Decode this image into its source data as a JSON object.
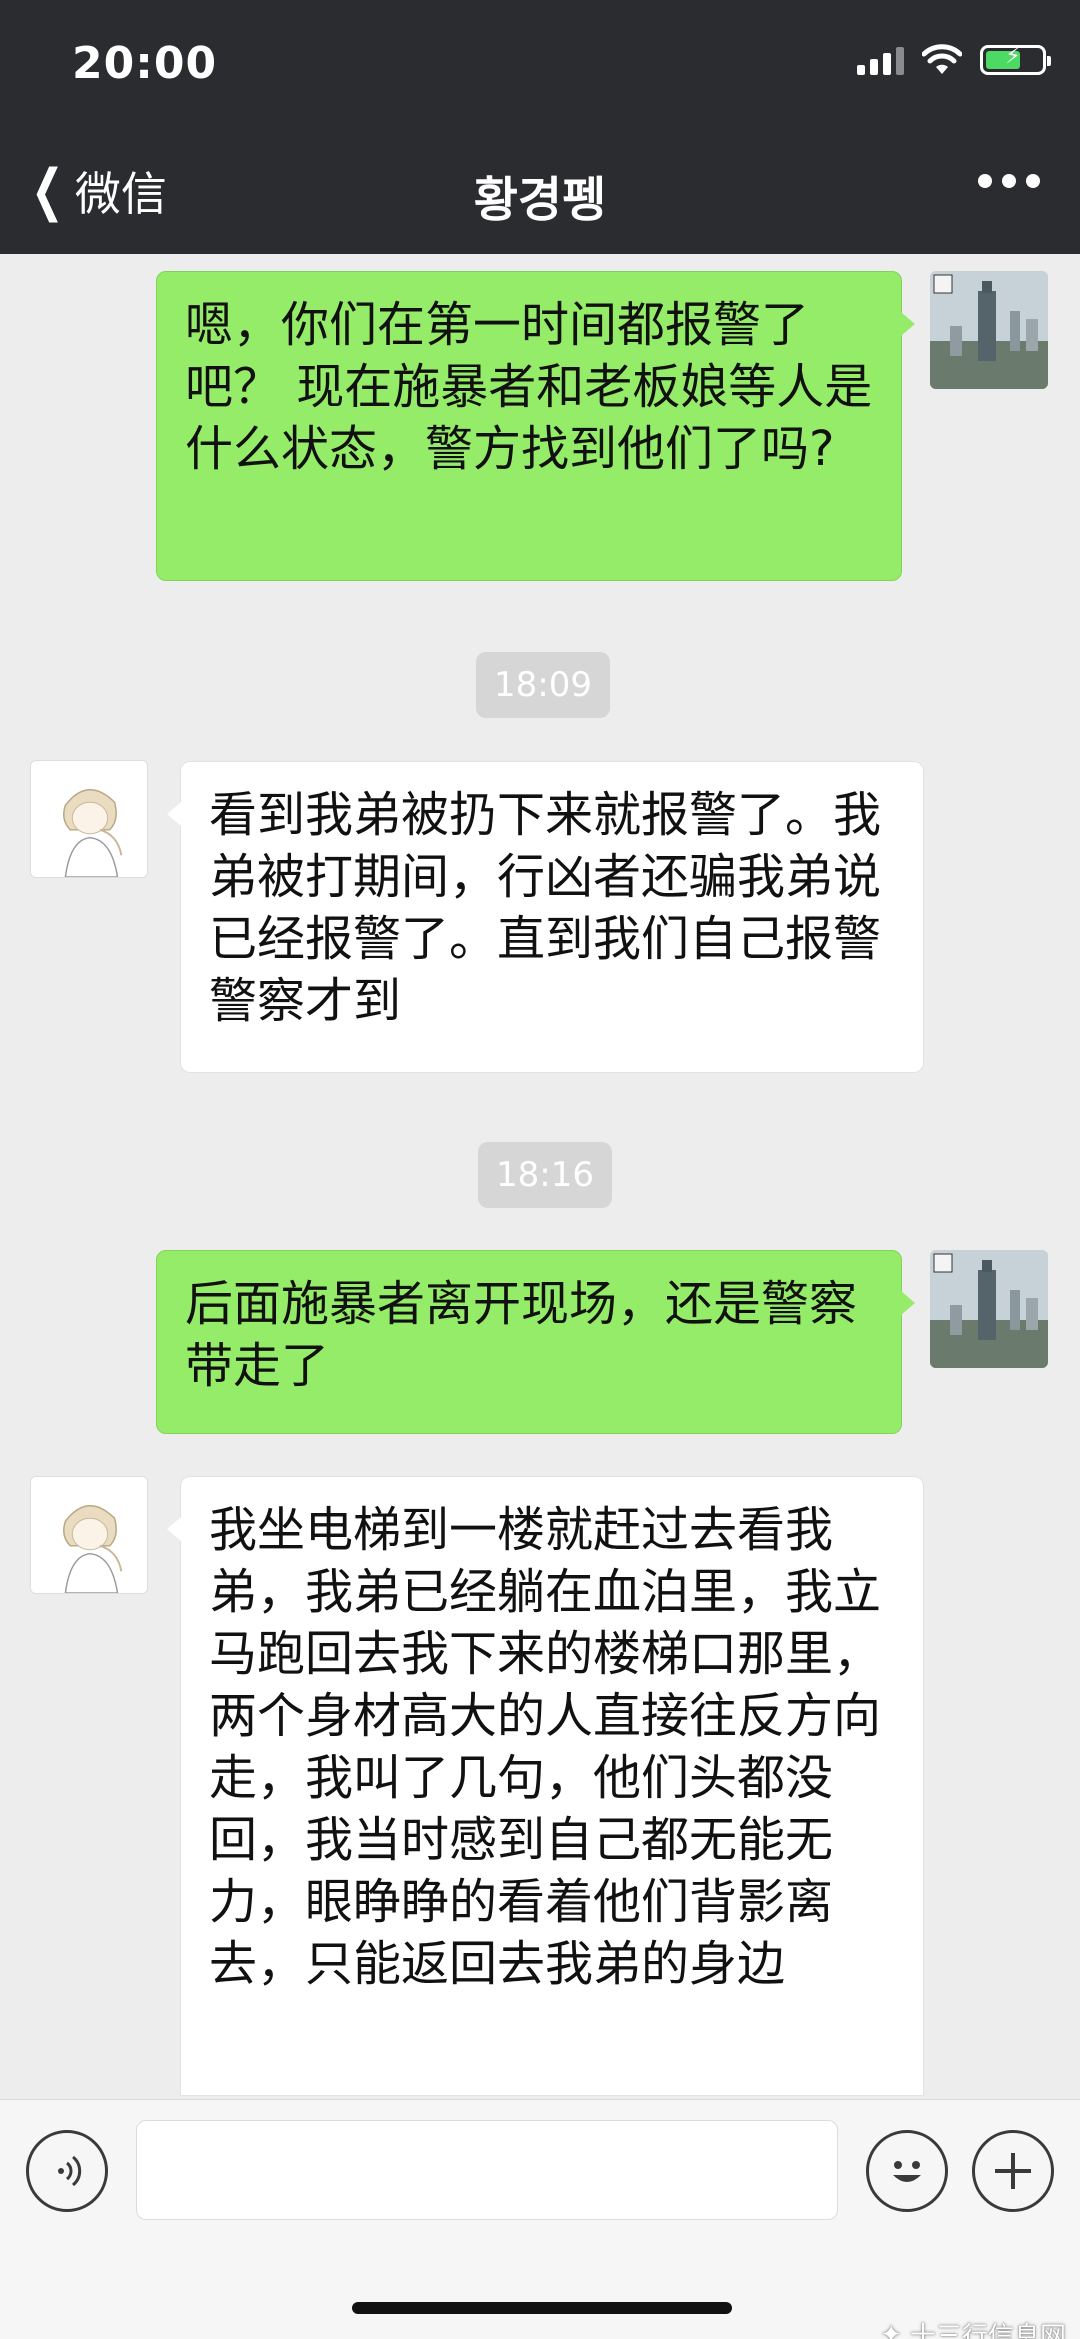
{
  "status_bar": {
    "time": "20:00"
  },
  "nav": {
    "back_label": "微信",
    "title": "황경펭"
  },
  "messages": [
    {
      "sender": "self",
      "text": "嗯，你们在第一时间都报警了吧？ 现在施暴者和老板娘等人是什么状态，警方找到他们了吗?"
    },
    {
      "type": "timestamp",
      "text": "18:09"
    },
    {
      "sender": "other",
      "text": "看到我弟被扔下来就报警了。我弟被打期间，行凶者还骗我弟说已经报警了。直到我们自己报警警察才到"
    },
    {
      "type": "timestamp",
      "text": "18:16"
    },
    {
      "sender": "self",
      "text": "后面施暴者离开现场，还是警察带走了"
    },
    {
      "sender": "other",
      "text": "我坐电梯到一楼就赶过去看我弟，我弟已经躺在血泊里，我立马跑回去我下来的楼梯口那里，两个身材高大的人直接往反方向走，我叫了几句，他们头都没回，我当时感到自己都无能无力，眼睁睁的看着他们背影离去，只能返回去我弟的身边"
    }
  ],
  "input_bar": {
    "voice_icon": "voice-icon",
    "emoji_icon": "emoji-icon",
    "plus_icon": "plus-icon",
    "value": ""
  },
  "watermark": {
    "text": "十三行信息网"
  },
  "colors": {
    "header_bg": "#2b2c30",
    "chat_bg": "#ededed",
    "self_bubble": "#95ec69",
    "other_bubble": "#ffffff",
    "battery_green": "#4cd964"
  }
}
